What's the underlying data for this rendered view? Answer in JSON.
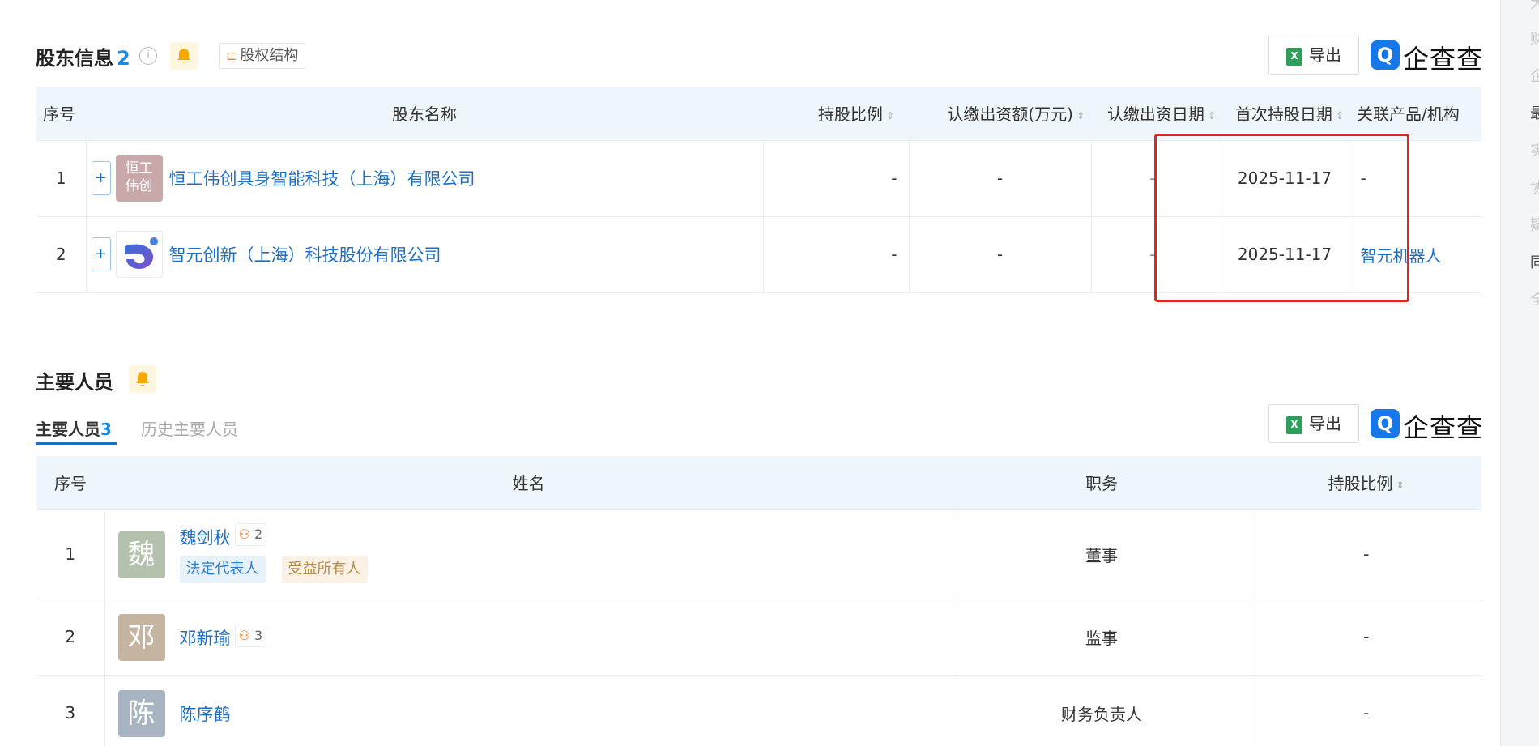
{
  "shareholders": {
    "title": "股东信息",
    "count": "2",
    "structure_label": "股权结构",
    "export_label": "导出",
    "brand": "企查查",
    "columns": [
      "序号",
      "股东名称",
      "持股比例",
      "认缴出资额(万元)",
      "认缴出资日期",
      "首次持股日期",
      "关联产品/机构"
    ],
    "rows": [
      {
        "no": "1",
        "logo_text": "恒工伟创",
        "name": "恒工伟创具身智能科技（上海）有限公司",
        "ratio": "-",
        "amount": "-",
        "subscribe_date": "-",
        "first_date": "2025-11-17",
        "related": "-"
      },
      {
        "no": "2",
        "logo_text": "",
        "name": "智元创新（上海）科技股份有限公司",
        "ratio": "-",
        "amount": "-",
        "subscribe_date": "-",
        "first_date": "2025-11-17",
        "related": "智元机器人"
      }
    ]
  },
  "personnel": {
    "title": "主要人员",
    "tab_active": "主要人员",
    "tab_active_count": "3",
    "tab_history": "历史主要人员",
    "export_label": "导出",
    "brand": "企查查",
    "columns": [
      "序号",
      "姓名",
      "职务",
      "持股比例"
    ],
    "rows": [
      {
        "no": "1",
        "avatar": "魏",
        "name": "魏剑秋",
        "relations": "2",
        "tags": [
          "法定代表人",
          "受益所有人"
        ],
        "role": "董事",
        "ratio": "-"
      },
      {
        "no": "2",
        "avatar": "邓",
        "name": "邓新瑜",
        "relations": "3",
        "tags": [],
        "role": "监事",
        "ratio": "-"
      },
      {
        "no": "3",
        "avatar": "陈",
        "name": "陈序鹤",
        "relations": "",
        "tags": [],
        "role": "财务负责人",
        "ratio": "-"
      }
    ]
  },
  "right_rail": [
    "大",
    "财",
    "企",
    "最",
    "实",
    "协",
    "疑",
    "同",
    "全"
  ],
  "colors": {
    "link": "#1e6fc1",
    "accent": "#1e88e5",
    "highlight_box": "#e02424",
    "header_bg": "#eef6fb"
  }
}
